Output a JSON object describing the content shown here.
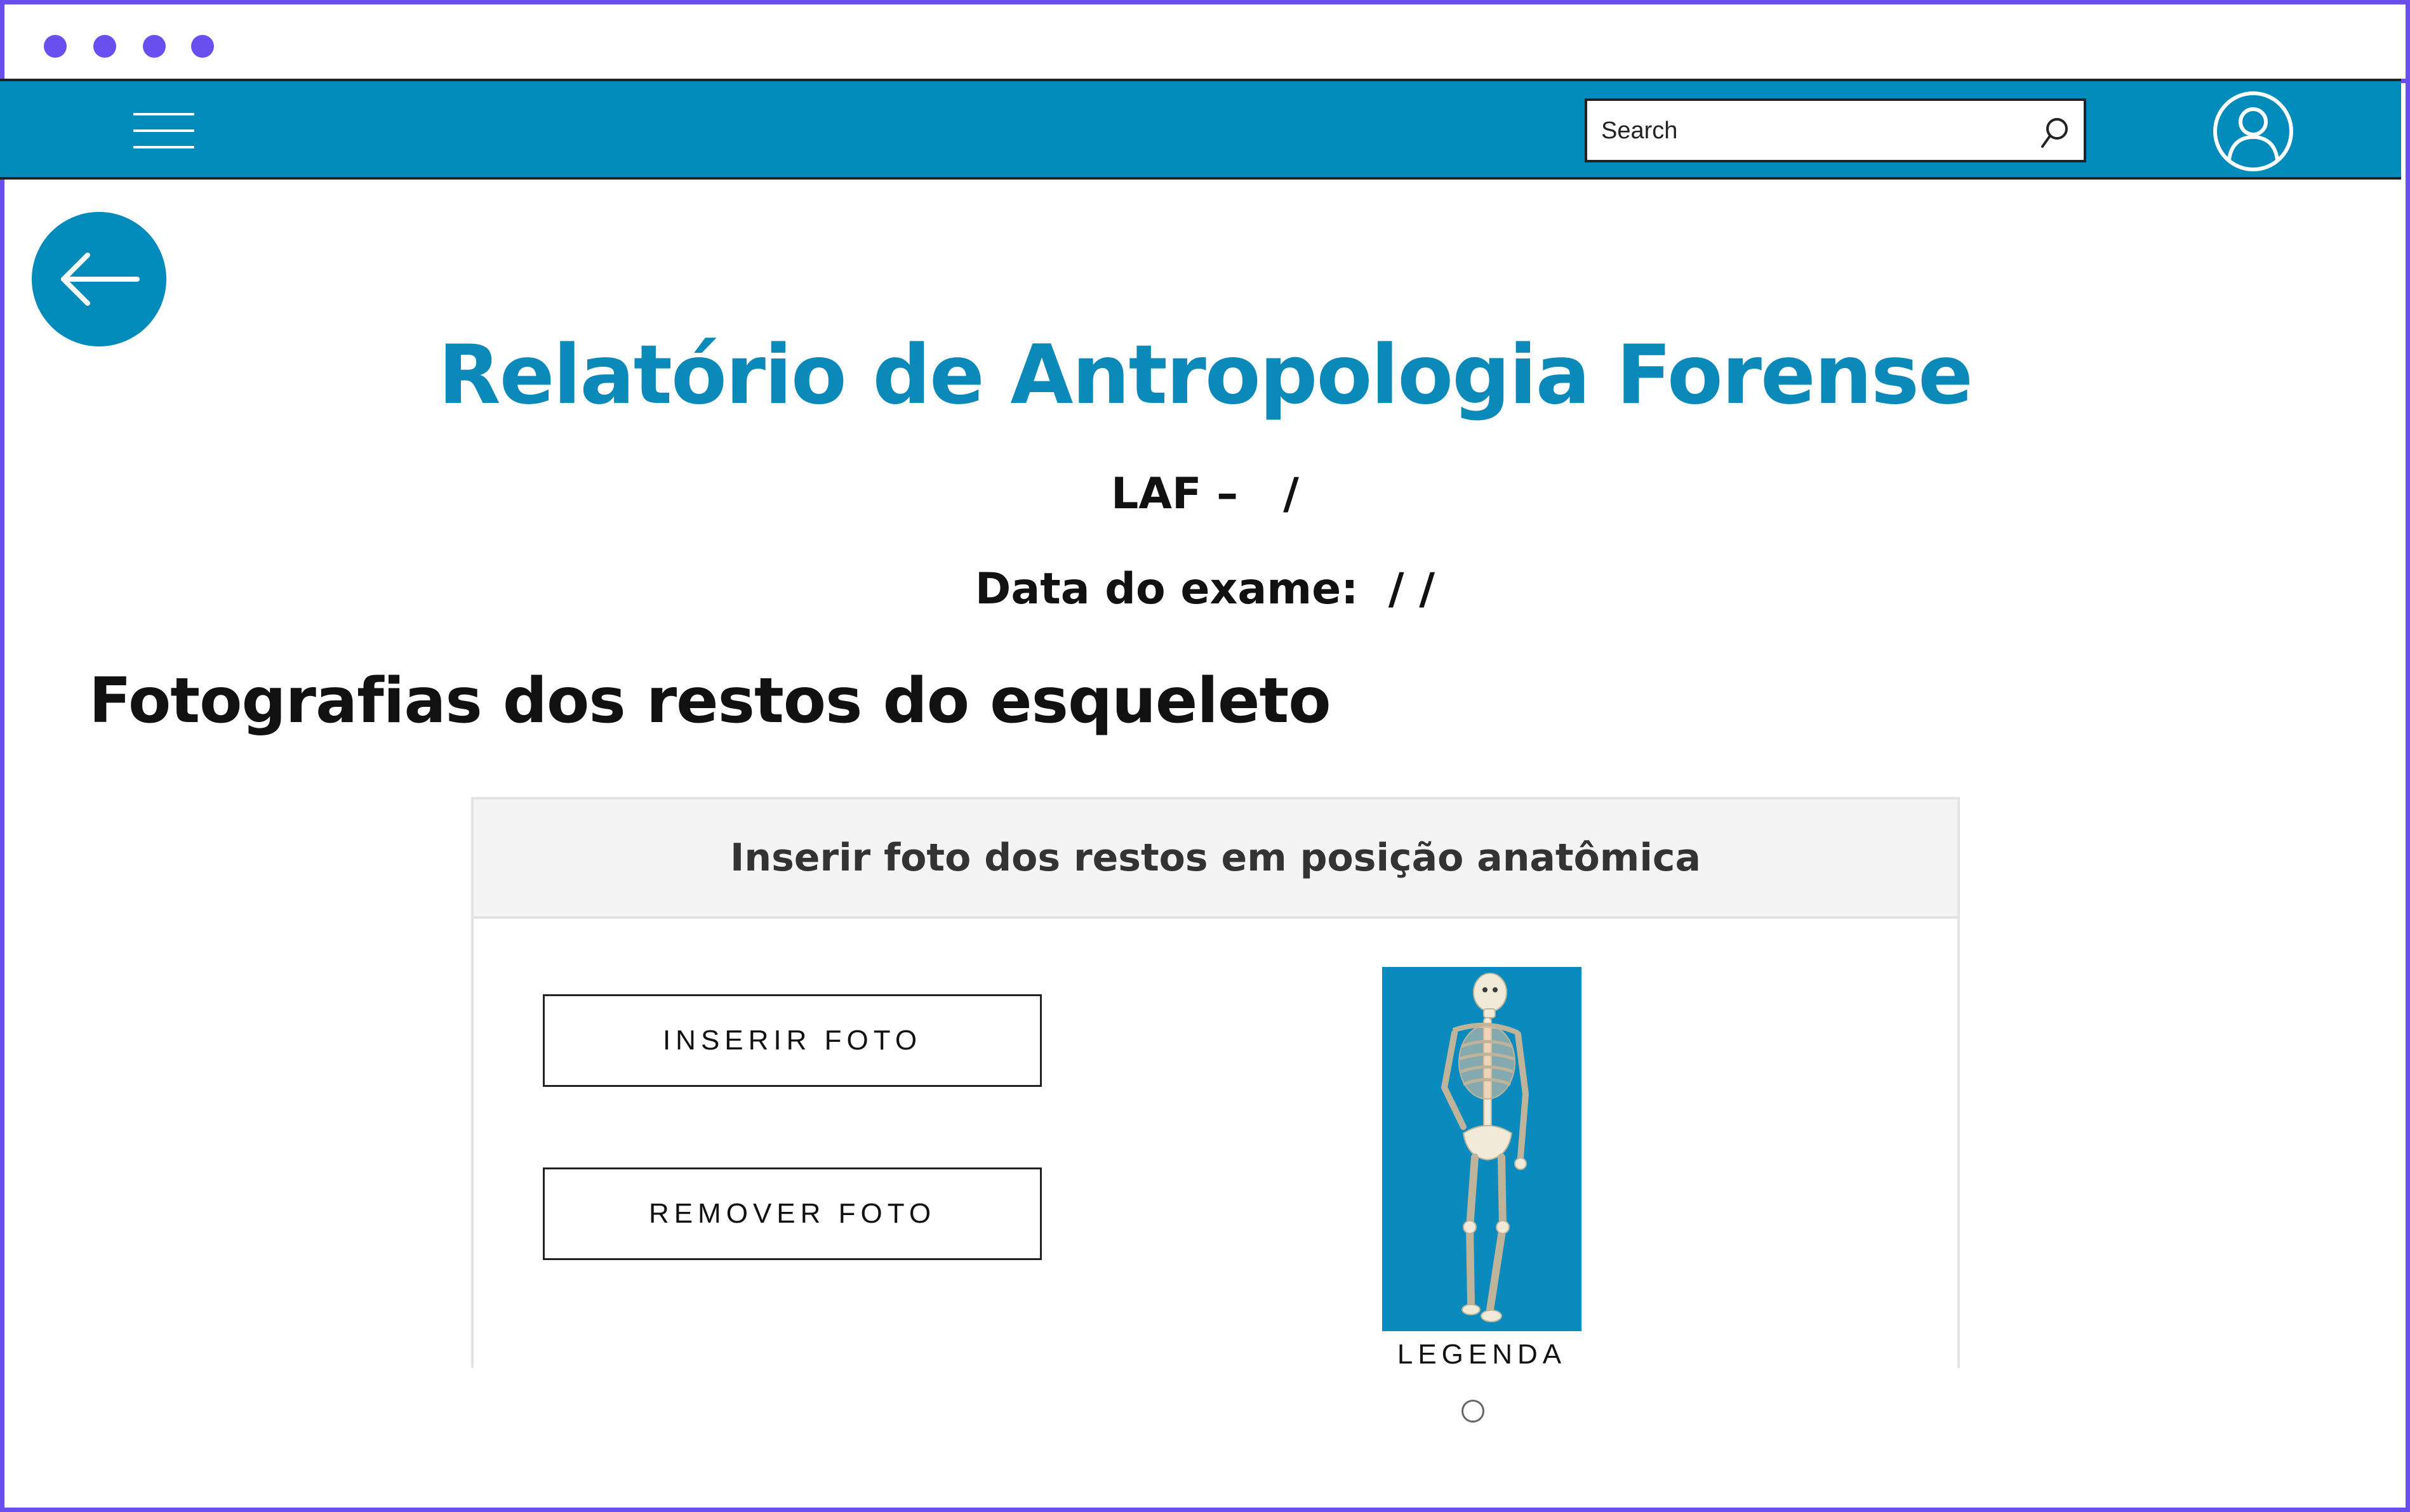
{
  "window": {
    "dots_color": "#6a4ff0",
    "frame_color": "#6a4ff0"
  },
  "navbar": {
    "background": "#008bbb",
    "menu_icon": "hamburger-menu-icon",
    "search": {
      "placeholder": "Search",
      "icon": "search-icon"
    },
    "profile_icon": "user-profile-icon"
  },
  "back_button": {
    "icon": "arrow-left-icon"
  },
  "page": {
    "title": "Relatório de Antropologia Forense",
    "title_color": "#0b89b8",
    "laf_line": "LAF –   /",
    "exam_date_line": "Data do exame:  / /",
    "section_heading": "Fotografias dos restos do esqueleto"
  },
  "photo_card": {
    "header": "Inserir foto dos restos em posição anatômica",
    "insert_button": "INSERIR FOTO",
    "remove_button": "REMOVER FOTO",
    "photo_alt": "skeleton-photo",
    "photo_background": "#0b8bbd",
    "caption": "LEGENDA"
  }
}
